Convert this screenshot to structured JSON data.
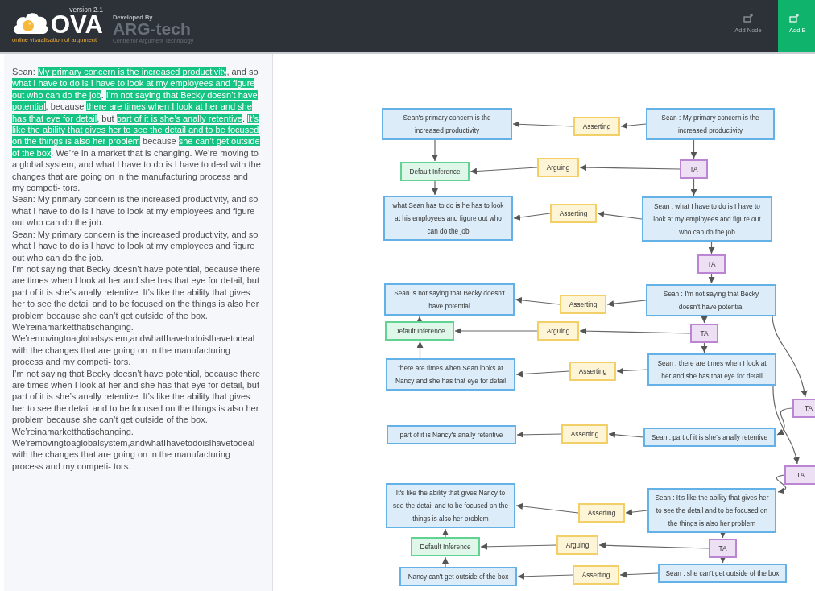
{
  "header": {
    "version": "version 2.1",
    "logo": "OVA",
    "tagline": "online visualisation of argument",
    "developed_by": "Developed By",
    "developer": "ARG-tech",
    "developer_tagline": "Centre for Argument Technology",
    "buttons": [
      {
        "label": "Add Node",
        "selected": false
      },
      {
        "label": "Add E",
        "selected": true
      }
    ]
  },
  "transcript": {
    "segments": [
      {
        "text": "Sean: ",
        "highlighted": false
      },
      {
        "text": "My primary concern is the increased productivity",
        "highlighted": true
      },
      {
        "text": ", and so ",
        "highlighted": false
      },
      {
        "text": "what I have to do is I have to look at my employees and figure out who can do the job",
        "highlighted": true
      },
      {
        "text": ". ",
        "highlighted": false
      },
      {
        "text": "I’m not saying that Becky doesn’t have potential",
        "highlighted": true
      },
      {
        "text": ", because ",
        "highlighted": false
      },
      {
        "text": "there are times when I look at her and she has that eye for detail",
        "highlighted": true
      },
      {
        "text": ", but ",
        "highlighted": false
      },
      {
        "text": "part of it is she’s anally retentive",
        "highlighted": true
      },
      {
        "text": ". ",
        "highlighted": false
      },
      {
        "text": "It’s like the ability that gives her to see the detail and to be focused on the things is also her problem",
        "highlighted": true
      },
      {
        "text": " because ",
        "highlighted": false
      },
      {
        "text": "she can’t get outside of the box",
        "highlighted": true
      },
      {
        "text": ". We’re in a market that is changing. We’re moving to a global system, and what I have to do is I have to deal with the changes that are going on in the manufacturing process and my competi- tors.",
        "highlighted": false
      }
    ],
    "paragraphs": [
      "Sean: My primary concern is the increased productivity, and so what I have to do is I have to look at my employees and figure out who can do the job.",
      "Sean: My primary concern is the increased productivity, and so what I have to do is I have to look at my employees and figure out who can do the job.",
      "I’m not saying that Becky doesn’t have potential, because there are times when I look at her and she has that eye for detail, but part of it is she’s anally retentive. It’s like the ability that gives her to see the detail and to be focused on the things is also her problem because she can’t get outside of the box. We’reinamarketthatischanging. We’removingtoaglobalsystem,andwhatIhavetodoisIhavetodealwith the changes that are going on in the manufacturing process and my competi- tors.",
      "I’m not saying that Becky doesn’t have potential, because there are times when I look at her and she has that eye for detail, but part of it is she’s anally retentive. It’s like the ability that gives her to see the detail and to be focused on the things is also her problem because she can’t get outside of the box. We’reinamarketthatischanging. We’removingtoaglobalsystem,andwhatIhavetodoisIhavetodealwith the changes that are going on in the manufacturing process and my competi- tors."
    ]
  },
  "diagram": {
    "nodes": [
      {
        "kind": "proposition",
        "text": "Sean's primary concern is the increased productivity"
      },
      {
        "kind": "asserting",
        "text": "Asserting"
      },
      {
        "kind": "locution",
        "text": "Sean : My primary concern is the increased productivity"
      },
      {
        "kind": "inference",
        "text": "Default Inference"
      },
      {
        "kind": "arguing",
        "text": "Arguing"
      },
      {
        "kind": "transition",
        "text": "TA"
      },
      {
        "kind": "proposition",
        "text": "what Sean has to do is he has to look at his employees and figure out who can do the job"
      },
      {
        "kind": "asserting",
        "text": "Asserting"
      },
      {
        "kind": "locution",
        "text": "Sean : what I have to do is I have to look at my employees and figure out who can do the job"
      },
      {
        "kind": "transition",
        "text": "TA"
      },
      {
        "kind": "proposition",
        "text": "Sean is not saying that Becky doesn't have potential"
      },
      {
        "kind": "asserting",
        "text": "Asserting"
      },
      {
        "kind": "locution",
        "text": "Sean : I'm not saying that Becky doesn't have potential"
      },
      {
        "kind": "inference",
        "text": "Default Inference"
      },
      {
        "kind": "arguing",
        "text": "Arguing"
      },
      {
        "kind": "transition",
        "text": "TA"
      },
      {
        "kind": "proposition",
        "text": "there are times when Sean looks at Nancy and she has that eye for detail"
      },
      {
        "kind": "asserting",
        "text": "Asserting"
      },
      {
        "kind": "locution",
        "text": "Sean : there are times when I look at her and she has that eye for detail"
      },
      {
        "kind": "transition",
        "text": "TA"
      },
      {
        "kind": "proposition",
        "text": "part of it is Nancy's anally retentive"
      },
      {
        "kind": "asserting",
        "text": "Asserting"
      },
      {
        "kind": "locution",
        "text": "Sean : part of it is she's anally retentive"
      },
      {
        "kind": "transition",
        "text": "TA"
      },
      {
        "kind": "proposition",
        "text": "It's like the ability that gives Nancy to see the detail and to be focused on the things is also her problem"
      },
      {
        "kind": "asserting",
        "text": "Asserting"
      },
      {
        "kind": "locution",
        "text": "Sean : It's like the ability that gives her to see the detail and to be focused on the things is also her problem"
      },
      {
        "kind": "inference",
        "text": "Default Inference"
      },
      {
        "kind": "arguing",
        "text": "Arguing"
      },
      {
        "kind": "transition",
        "text": "TA"
      },
      {
        "kind": "proposition",
        "text": "Nancy can't get outside of the box"
      },
      {
        "kind": "asserting",
        "text": "Asserting"
      },
      {
        "kind": "locution",
        "text": "Sean : she can't get outside of the box"
      }
    ]
  }
}
